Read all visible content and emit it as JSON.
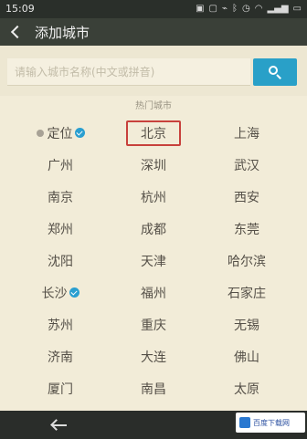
{
  "status_bar": {
    "time": "15:09",
    "icons": [
      "notification-icon",
      "image-icon",
      "usb-icon",
      "bluetooth-icon",
      "alarm-icon",
      "wifi-icon",
      "signal-icon",
      "battery-icon"
    ],
    "battery": ""
  },
  "header": {
    "title": "添加城市"
  },
  "search": {
    "placeholder": "请输入城市名称(中文或拼音)"
  },
  "hot_cities": {
    "header": "热门城市",
    "cities": [
      {
        "name": "定位",
        "located": true,
        "checked": true,
        "highlighted": false
      },
      {
        "name": "北京",
        "located": false,
        "checked": false,
        "highlighted": true
      },
      {
        "name": "上海",
        "located": false,
        "checked": false,
        "highlighted": false
      },
      {
        "name": "广州",
        "located": false,
        "checked": false,
        "highlighted": false
      },
      {
        "name": "深圳",
        "located": false,
        "checked": false,
        "highlighted": false
      },
      {
        "name": "武汉",
        "located": false,
        "checked": false,
        "highlighted": false
      },
      {
        "name": "南京",
        "located": false,
        "checked": false,
        "highlighted": false
      },
      {
        "name": "杭州",
        "located": false,
        "checked": false,
        "highlighted": false
      },
      {
        "name": "西安",
        "located": false,
        "checked": false,
        "highlighted": false
      },
      {
        "name": "郑州",
        "located": false,
        "checked": false,
        "highlighted": false
      },
      {
        "name": "成都",
        "located": false,
        "checked": false,
        "highlighted": false
      },
      {
        "name": "东莞",
        "located": false,
        "checked": false,
        "highlighted": false
      },
      {
        "name": "沈阳",
        "located": false,
        "checked": false,
        "highlighted": false
      },
      {
        "name": "天津",
        "located": false,
        "checked": false,
        "highlighted": false
      },
      {
        "name": "哈尔滨",
        "located": false,
        "checked": false,
        "highlighted": false
      },
      {
        "name": "长沙",
        "located": false,
        "checked": true,
        "highlighted": false
      },
      {
        "name": "福州",
        "located": false,
        "checked": false,
        "highlighted": false
      },
      {
        "name": "石家庄",
        "located": false,
        "checked": false,
        "highlighted": false
      },
      {
        "name": "苏州",
        "located": false,
        "checked": false,
        "highlighted": false
      },
      {
        "name": "重庆",
        "located": false,
        "checked": false,
        "highlighted": false
      },
      {
        "name": "无锡",
        "located": false,
        "checked": false,
        "highlighted": false
      },
      {
        "name": "济南",
        "located": false,
        "checked": false,
        "highlighted": false
      },
      {
        "name": "大连",
        "located": false,
        "checked": false,
        "highlighted": false
      },
      {
        "name": "佛山",
        "located": false,
        "checked": false,
        "highlighted": false
      },
      {
        "name": "厦门",
        "located": false,
        "checked": false,
        "highlighted": false
      },
      {
        "name": "南昌",
        "located": false,
        "checked": false,
        "highlighted": false
      },
      {
        "name": "太原",
        "located": false,
        "checked": false,
        "highlighted": false
      }
    ]
  },
  "watermark": {
    "text": "百度下载网"
  },
  "colors": {
    "accent": "#29a0c8",
    "highlight_border": "#c8413c",
    "check": "#2a9fd0"
  }
}
